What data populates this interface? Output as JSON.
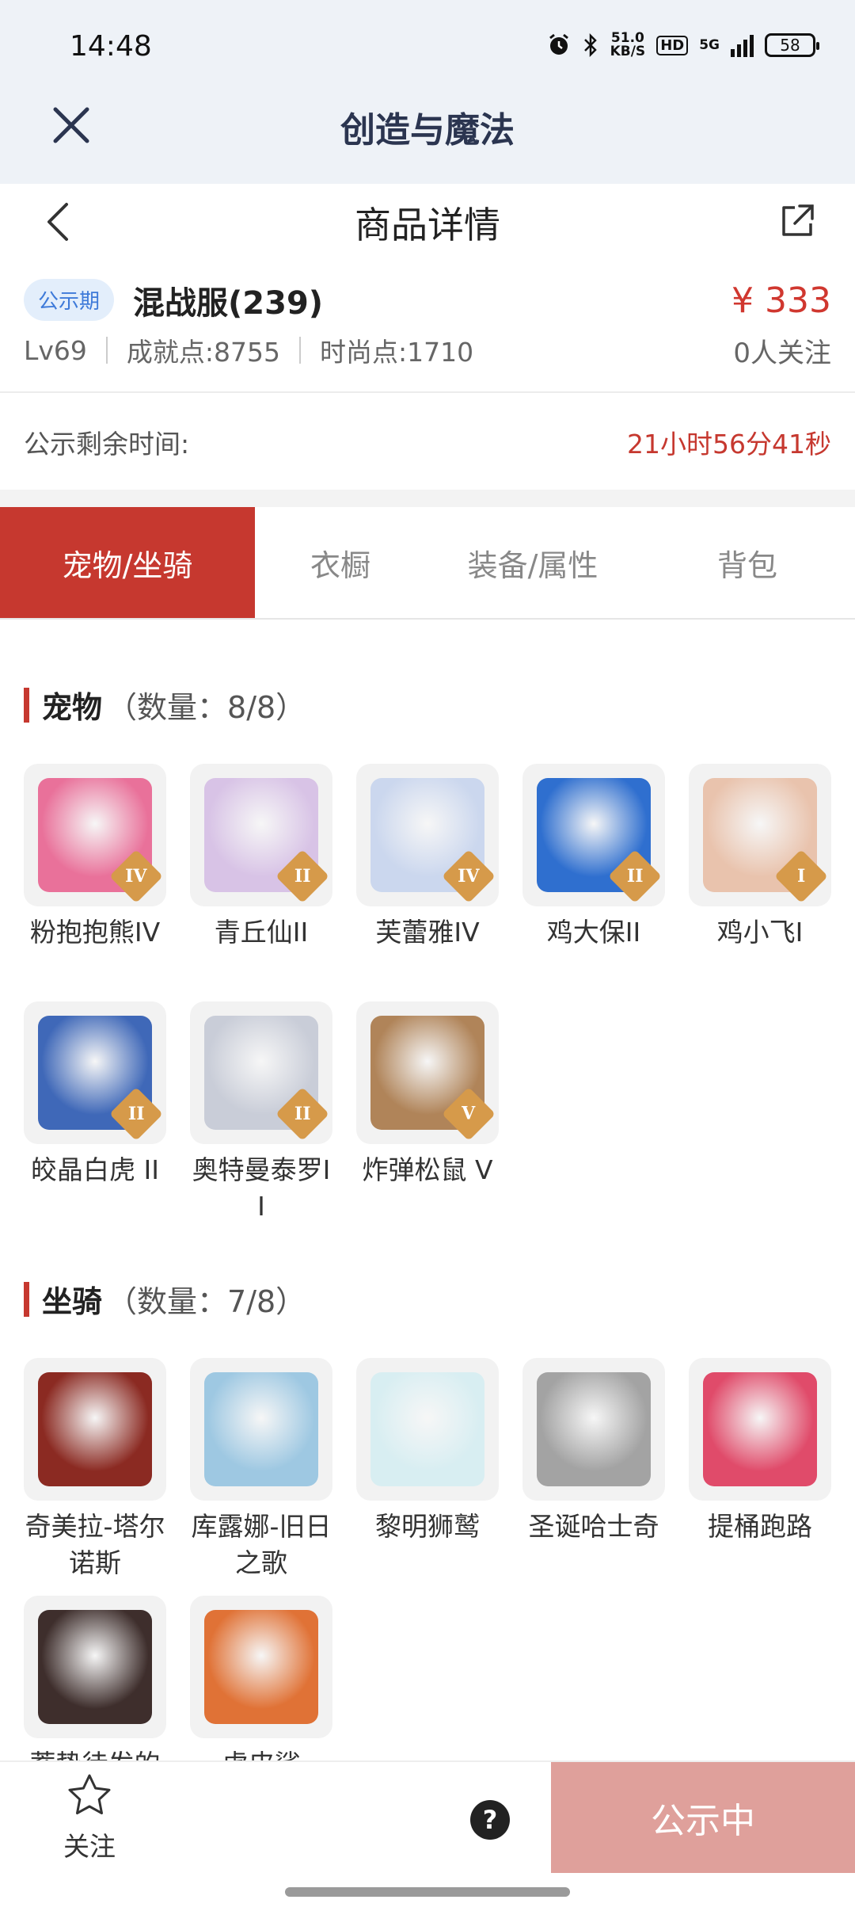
{
  "status_bar": {
    "time": "14:48",
    "net_speed_top": "51.0",
    "net_speed_bottom": "KB/S",
    "hd": "HD",
    "network": "5G",
    "battery": "58"
  },
  "app_bar": {
    "title": "创造与魔法"
  },
  "header": {
    "title": "商品详情"
  },
  "item": {
    "badge": "公示期",
    "name": "混战服(239)",
    "price": "¥ 333",
    "level": "Lv69",
    "achievement": "成就点:8755",
    "fashion": "时尚点:1710",
    "follows": "0人关注"
  },
  "timer": {
    "label": "公示剩余时间:",
    "value": "21小时56分41秒"
  },
  "tabs": [
    {
      "label": "宠物/坐骑"
    },
    {
      "label": "衣橱"
    },
    {
      "label": "装备/属性"
    },
    {
      "label": "背包"
    }
  ],
  "pets": {
    "title": "宠物",
    "count": "（数量：8/8）",
    "items": [
      {
        "label": "粉抱抱熊IV",
        "tier": "IV",
        "color": "#e9719a"
      },
      {
        "label": "青丘仙II",
        "tier": "II",
        "color": "#d8c3e6"
      },
      {
        "label": "芙蕾雅IV",
        "tier": "IV",
        "color": "#cbd7ee"
      },
      {
        "label": "鸡大保II",
        "tier": "II",
        "color": "#2f6fcf"
      },
      {
        "label": "鸡小飞I",
        "tier": "I",
        "color": "#e9c3ad"
      },
      {
        "label": "皎晶白虎 II",
        "tier": "II",
        "color": "#3f68b8"
      },
      {
        "label": "奥特曼泰罗II",
        "tier": "II",
        "color": "#c9cdd8"
      },
      {
        "label": "炸弹松鼠 V",
        "tier": "V",
        "color": "#b08459"
      }
    ]
  },
  "mounts": {
    "title": "坐骑",
    "count": "（数量：7/8）",
    "items": [
      {
        "label": "奇美拉-塔尔诺斯",
        "color": "#8b2a22"
      },
      {
        "label": "库露娜-旧日之歌",
        "color": "#9ec8e2"
      },
      {
        "label": "黎明狮鹫",
        "color": "#d8eef2"
      },
      {
        "label": "圣诞哈士奇",
        "color": "#a3a3a3"
      },
      {
        "label": "提桶跑路",
        "color": "#e04b6a"
      },
      {
        "label": "蓄势待发的",
        "color": "#3e2e2c"
      },
      {
        "label": "虎皮鲨",
        "color": "#e07236"
      }
    ]
  },
  "bottom": {
    "follow_label": "关注",
    "help": "?",
    "cta": "公示中"
  }
}
